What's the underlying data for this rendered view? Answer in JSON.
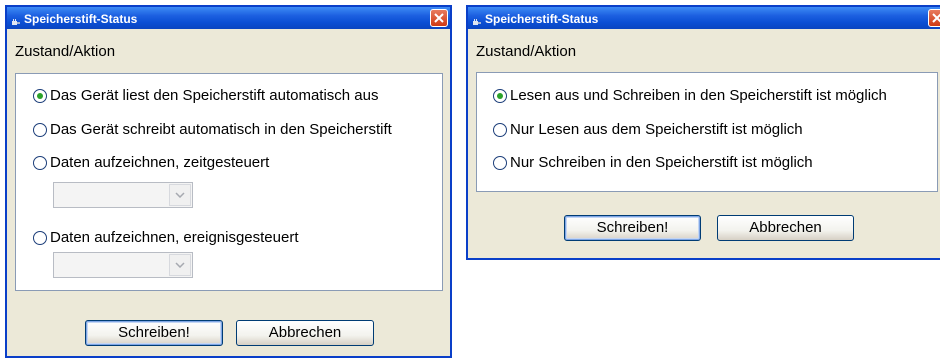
{
  "dialog_left": {
    "title": "Speicherstift-Status",
    "section_label": "Zustand/Aktion",
    "options": [
      {
        "label": "Das Gerät liest den Speicherstift automatisch aus",
        "checked": true
      },
      {
        "label": "Das Gerät schreibt automatisch in den Speicherstift",
        "checked": false
      },
      {
        "label": "Daten aufzeichnen, zeitgesteuert",
        "checked": false
      },
      {
        "label": "Daten aufzeichnen, ereignisgesteuert",
        "checked": false
      }
    ],
    "time_combo_value": "",
    "event_combo_value": "",
    "write_button": "Schreiben!",
    "cancel_button": "Abbrechen"
  },
  "dialog_right": {
    "title": "Speicherstift-Status",
    "section_label": "Zustand/Aktion",
    "options": [
      {
        "label": "Lesen aus und Schreiben in den Speicherstift ist möglich",
        "checked": true
      },
      {
        "label": "Nur Lesen aus dem Speicherstift ist möglich",
        "checked": false
      },
      {
        "label": "Nur Schreiben in den Speicherstift ist möglich",
        "checked": false
      }
    ],
    "write_button": "Schreiben!",
    "cancel_button": "Abbrechen"
  },
  "colors": {
    "titlebar": "#0b4fd4",
    "dialog_background": "#ece9d8",
    "selected_radio": "#2aa12a",
    "close_button": "#cf3a14"
  },
  "icons": {
    "title": "app-plug-icon",
    "close": "close-icon",
    "dropdown": "chevron-down-icon"
  }
}
